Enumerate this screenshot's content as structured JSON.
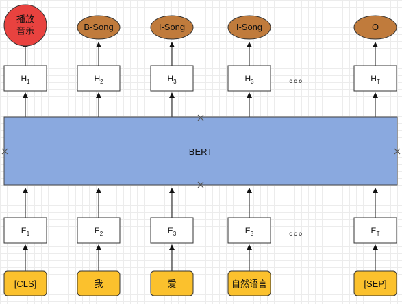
{
  "model": {
    "label": "BERT"
  },
  "columns": [
    {
      "output": "播放\n音乐",
      "output_kind": "intent",
      "hidden": "H",
      "hidden_sub": "1",
      "embed": "E",
      "embed_sub": "1",
      "token": "[CLS]"
    },
    {
      "output": "B-Song",
      "output_kind": "slot",
      "hidden": "H",
      "hidden_sub": "2",
      "embed": "E",
      "embed_sub": "2",
      "token": "我"
    },
    {
      "output": "I-Song",
      "output_kind": "slot",
      "hidden": "H",
      "hidden_sub": "3",
      "embed": "E",
      "embed_sub": "3",
      "token": "爱"
    },
    {
      "output": "I-Song",
      "output_kind": "slot",
      "hidden": "H",
      "hidden_sub": "3",
      "embed": "E",
      "embed_sub": "3",
      "token": "自然语言"
    },
    {
      "output": "O",
      "output_kind": "slot",
      "hidden": "H",
      "hidden_sub": "T",
      "embed": "E",
      "embed_sub": "T",
      "token": "[SEP]"
    }
  ],
  "ellipsis": "。。。",
  "colors": {
    "intent": "#e8423f",
    "slot": "#c07b3c",
    "bert": "#8aa9df",
    "token": "#fbc12d",
    "box_border": "#333333"
  }
}
